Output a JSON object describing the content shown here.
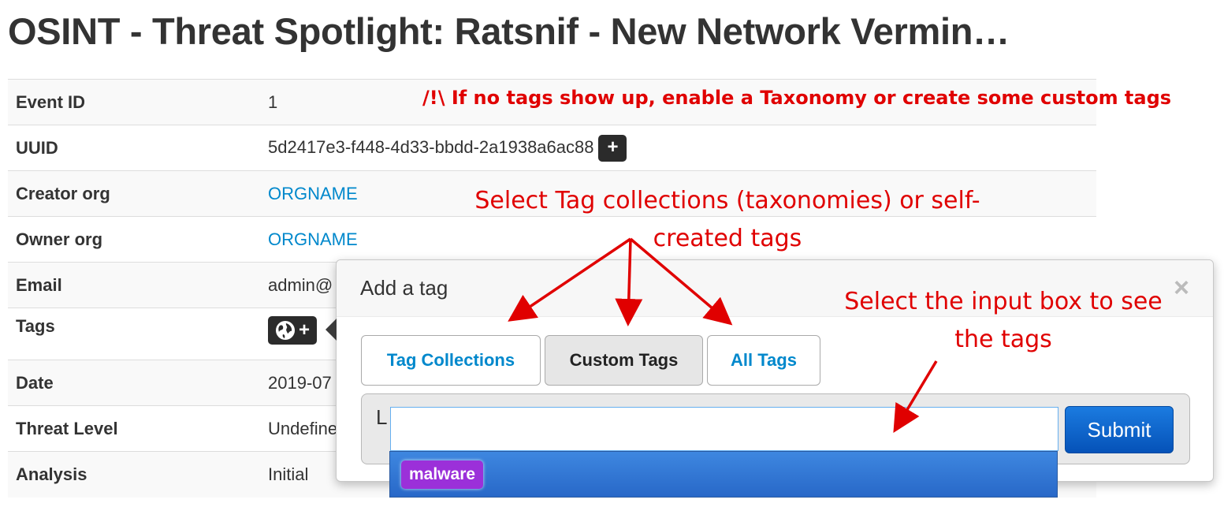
{
  "page": {
    "title": "OSINT - Threat Spotlight: Ratsnif - New Network Vermin…"
  },
  "event": {
    "rows": [
      {
        "key": "Event ID",
        "value": "1"
      },
      {
        "key": "UUID",
        "value": "5d2417e3-f448-4d33-bbdd-2a1938a6ac88"
      },
      {
        "key": "Creator org",
        "value": "ORGNAME"
      },
      {
        "key": "Owner org",
        "value": "ORGNAME"
      },
      {
        "key": "Email",
        "value": "admin@"
      },
      {
        "key": "Tags",
        "value": ""
      },
      {
        "key": "Date",
        "value": "2019-07"
      },
      {
        "key": "Threat Level",
        "value": "Undefine"
      },
      {
        "key": "Analysis",
        "value": "Initial"
      }
    ],
    "uuid_add_label": "+",
    "tags_add_label": "+"
  },
  "popover": {
    "title": "Add a tag",
    "close_label": "×",
    "tabs": [
      {
        "label": "Tag Collections",
        "active": false
      },
      {
        "label": "Custom Tags",
        "active": true
      },
      {
        "label": "All Tags",
        "active": false
      }
    ],
    "cursor_glyph": "L",
    "input": {
      "value": "",
      "placeholder": ""
    },
    "submit_label": "Submit",
    "dropdown": [
      {
        "label": "malware",
        "color": "#9b30d9"
      }
    ]
  },
  "annotations": {
    "warning": "/!\\ If no tags show up, enable a Taxonomy or create some custom tags",
    "collections_note": "Select Tag collections (taxonomies) or self-created tags",
    "input_note": "Select the input box to see the tags",
    "color": "#e00000"
  },
  "colors": {
    "link": "#0088cc",
    "submit": "#0552b8",
    "highlight": "#2868c8"
  },
  "icons": {
    "tags_globe": "globe-icon"
  }
}
